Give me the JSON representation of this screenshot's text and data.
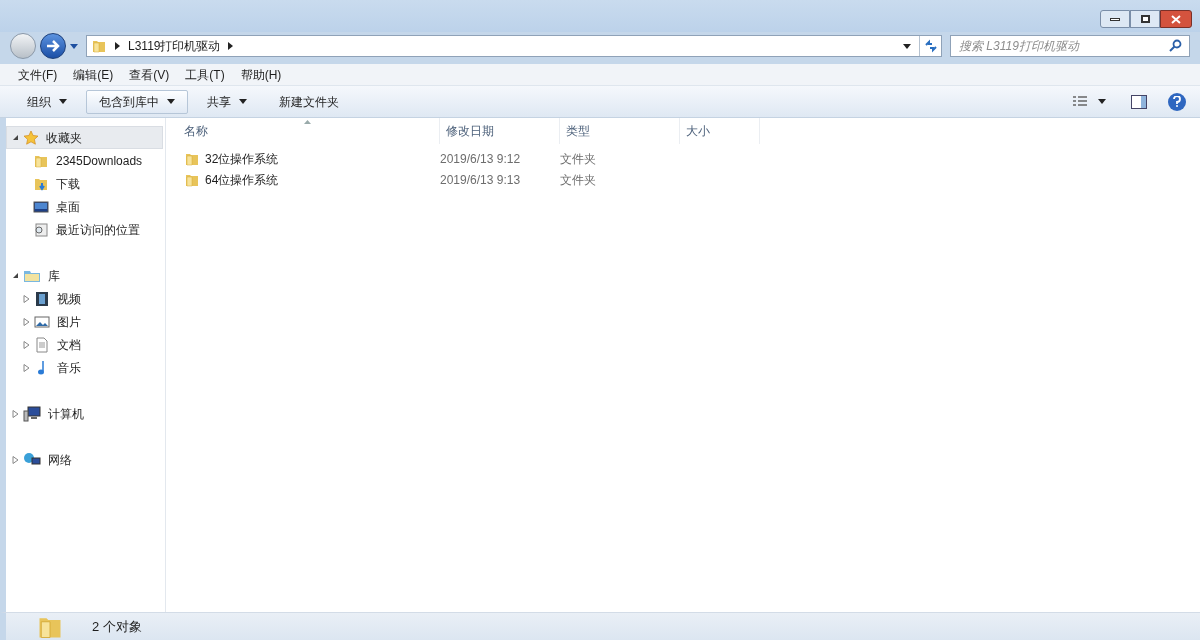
{
  "address": {
    "crumbs": [
      "L3119打印机驱动"
    ]
  },
  "search": {
    "placeholder": "搜索 L3119打印机驱动"
  },
  "menu": [
    "文件(F)",
    "编辑(E)",
    "查看(V)",
    "工具(T)",
    "帮助(H)"
  ],
  "toolbar": [
    {
      "label": "组织",
      "dropdown": true,
      "selected": false
    },
    {
      "label": "包含到库中",
      "dropdown": true,
      "selected": true
    },
    {
      "label": "共享",
      "dropdown": true,
      "selected": false
    },
    {
      "label": "新建文件夹",
      "dropdown": false,
      "selected": false
    }
  ],
  "sidebar": [
    {
      "label": "收藏夹",
      "kind": "star",
      "expanded": true,
      "selected": true,
      "children": [
        {
          "label": "2345Downloads",
          "kind": "folder",
          "selected": false
        },
        {
          "label": "下载",
          "kind": "download",
          "selected": false
        },
        {
          "label": "桌面",
          "kind": "desktop",
          "selected": false
        },
        {
          "label": "最近访问的位置",
          "kind": "recent",
          "selected": false
        }
      ]
    },
    {
      "label": "库",
      "kind": "library",
      "expanded": true,
      "selected": false,
      "children": [
        {
          "label": "视频",
          "kind": "video",
          "selected": false
        },
        {
          "label": "图片",
          "kind": "picture",
          "selected": false
        },
        {
          "label": "文档",
          "kind": "document",
          "selected": false
        },
        {
          "label": "音乐",
          "kind": "music",
          "selected": false
        }
      ]
    },
    {
      "label": "计算机",
      "kind": "computer",
      "expanded": false,
      "selected": false
    },
    {
      "label": "网络",
      "kind": "network",
      "expanded": false,
      "selected": false
    }
  ],
  "table": {
    "columns": [
      "名称",
      "修改日期",
      "类型",
      "大小"
    ],
    "rows": [
      {
        "name": "32位操作系统",
        "date": "2019/6/13 9:12",
        "type": "文件夹"
      },
      {
        "name": "64位操作系统",
        "date": "2019/6/13 9:13",
        "type": "文件夹"
      }
    ]
  },
  "status_bar": {
    "text": "2 个对象"
  }
}
